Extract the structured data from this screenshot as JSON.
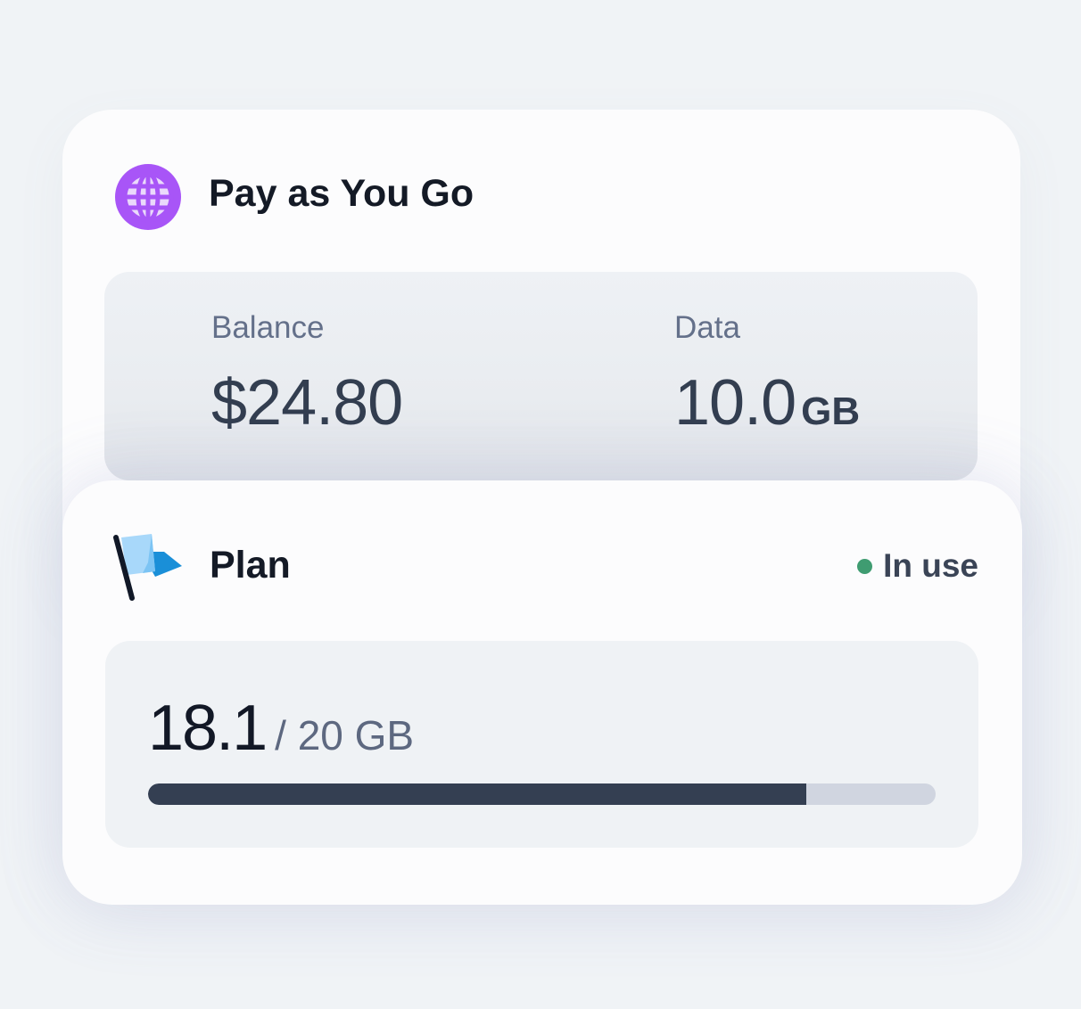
{
  "payg": {
    "title": "Pay as You Go",
    "icon": "globe-icon",
    "balance": {
      "label": "Balance",
      "value": "$24.80"
    },
    "data": {
      "label": "Data",
      "value": "10.0",
      "unit": "GB"
    }
  },
  "plan": {
    "title": "Plan",
    "icon": "flag-icon",
    "status": {
      "label": "In use",
      "color": "#3f9c71"
    },
    "usage": {
      "used": "18.1",
      "total": "/ 20 GB",
      "fraction": 0.836
    }
  },
  "colors": {
    "accent_purple": "#a855f7",
    "flag_blue": "#1a8fd8",
    "progress_fill": "#343f52",
    "progress_track": "#d0d5e0"
  }
}
